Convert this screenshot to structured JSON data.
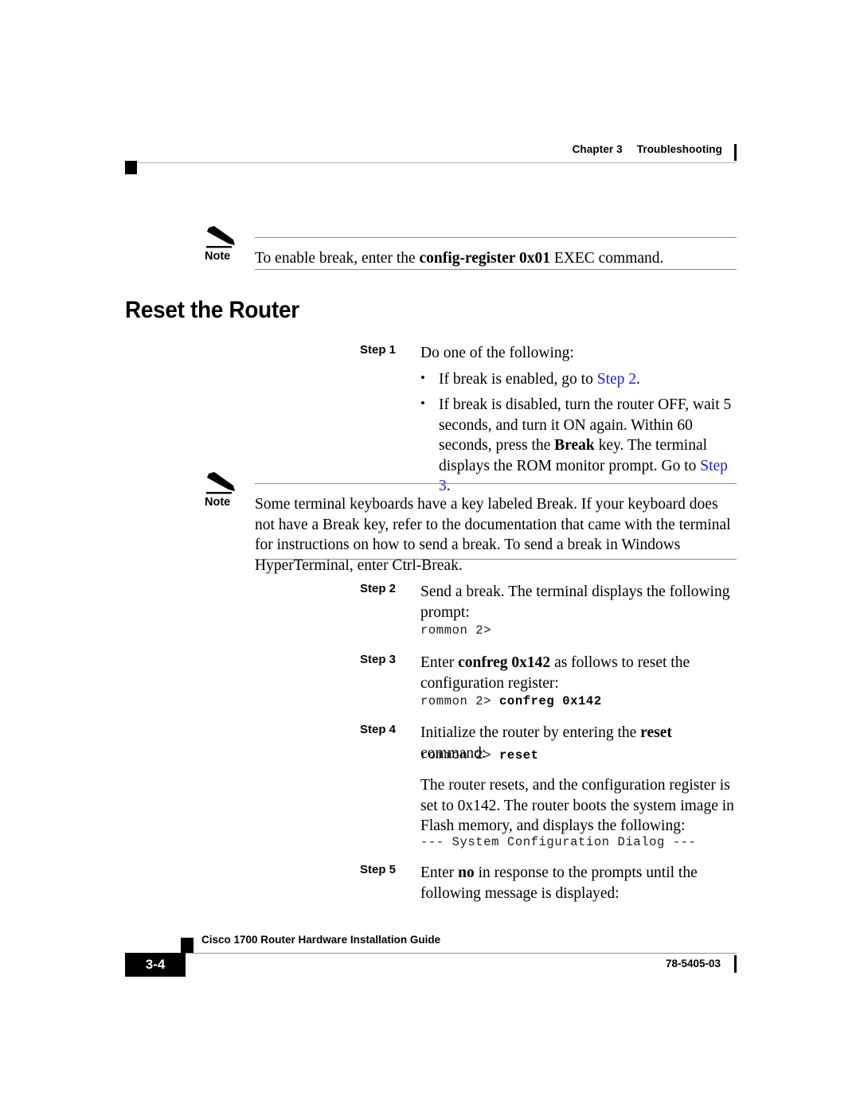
{
  "header": {
    "chapter": "Chapter 3",
    "section": "Troubleshooting"
  },
  "notes": [
    {
      "label": "Note",
      "icon": "pencil-icon",
      "text_parts": [
        {
          "text": "To enable break, enter the ",
          "style": "normal"
        },
        {
          "text": "config-register",
          "style": "bold"
        },
        {
          "text": " 0x01",
          "style": "bold"
        },
        {
          "text": " EXEC command.",
          "style": "normal"
        }
      ],
      "plain": "To enable break, enter the config-register 0x01 EXEC command."
    },
    {
      "label": "Note",
      "icon": "pencil-icon",
      "plain": "Some terminal keyboards have a key labeled Break. If your keyboard does not have a Break key, refer to the documentation that came with the terminal for instructions on how to send a break. To send a break in Windows HyperTerminal, enter Ctrl-Break."
    }
  ],
  "heading": "Reset the Router",
  "steps": {
    "step1": {
      "label": "Step 1",
      "intro": "Do one of the following:",
      "bullets": {
        "b1": {
          "pre": "If break is enabled, go to ",
          "link": "Step 2",
          "post": "."
        },
        "b2": {
          "pre": "If break is disabled, turn the router OFF, wait 5 seconds, and turn it ON again. Within 60 seconds, press the ",
          "bold": "Break",
          "mid": " key. The terminal displays the ROM monitor prompt. Go to ",
          "link": "Step 3",
          "post": "."
        }
      }
    },
    "step2": {
      "label": "Step 2",
      "text": "Send a break. The terminal displays the following prompt:",
      "code": "rommon 2>"
    },
    "step3": {
      "label": "Step 3",
      "pre": "Enter ",
      "bold": "confreg 0x142",
      "post": " as follows to reset the configuration register:",
      "code_prompt": "rommon 2> ",
      "code_input": "confreg 0x142"
    },
    "step4": {
      "label": "Step 4",
      "pre": "Initialize the router by entering the ",
      "bold": "reset",
      "post": " command:",
      "code_prompt": "rommon 2> ",
      "code_input": "reset",
      "result_text": "The router resets, and the configuration register is set to 0x142. The router boots the system image in Flash memory, and displays the following:",
      "result_code": "--- System Configuration Dialog ---"
    },
    "step5": {
      "label": "Step 5",
      "pre": "Enter ",
      "bold": "no",
      "post": " in response to the prompts until the following message is displayed:"
    }
  },
  "footer": {
    "page_number": "3-4",
    "title": "Cisco 1700 Router Hardware Installation Guide",
    "doc_number": "78-5405-03"
  },
  "colors": {
    "link": "#2222cc",
    "rule": "#8a8a8a",
    "text": "#000000"
  }
}
